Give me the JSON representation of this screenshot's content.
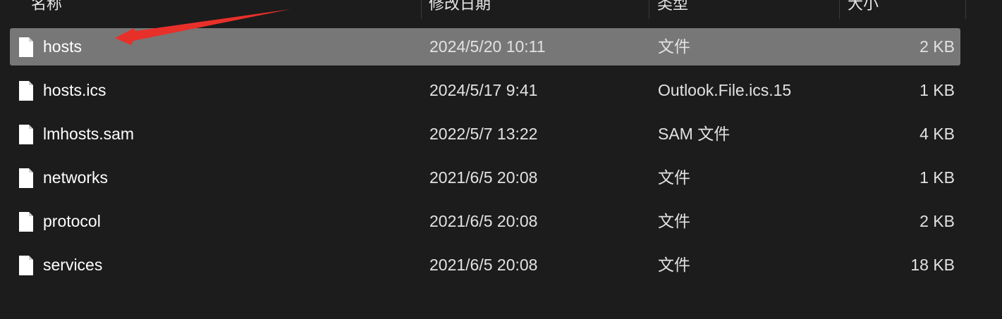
{
  "columns": {
    "name": "名称",
    "date": "修改日期",
    "type": "类型",
    "size": "大小"
  },
  "files": [
    {
      "name": "hosts",
      "date": "2024/5/20 10:11",
      "type": "文件",
      "size": "2 KB",
      "selected": true
    },
    {
      "name": "hosts.ics",
      "date": "2024/5/17 9:41",
      "type": "Outlook.File.ics.15",
      "size": "1 KB",
      "selected": false
    },
    {
      "name": "lmhosts.sam",
      "date": "2022/5/7 13:22",
      "type": "SAM 文件",
      "size": "4 KB",
      "selected": false
    },
    {
      "name": "networks",
      "date": "2021/6/5 20:08",
      "type": "文件",
      "size": "1 KB",
      "selected": false
    },
    {
      "name": "protocol",
      "date": "2021/6/5 20:08",
      "type": "文件",
      "size": "2 KB",
      "selected": false
    },
    {
      "name": "services",
      "date": "2021/6/5 20:08",
      "type": "文件",
      "size": "18 KB",
      "selected": false
    }
  ],
  "colors": {
    "background": "#1c1c1c",
    "selected_row": "#777777",
    "annotation_arrow": "#e8302a"
  },
  "icons": {
    "file": "file-icon",
    "annotation": "arrow-annotation-icon"
  }
}
